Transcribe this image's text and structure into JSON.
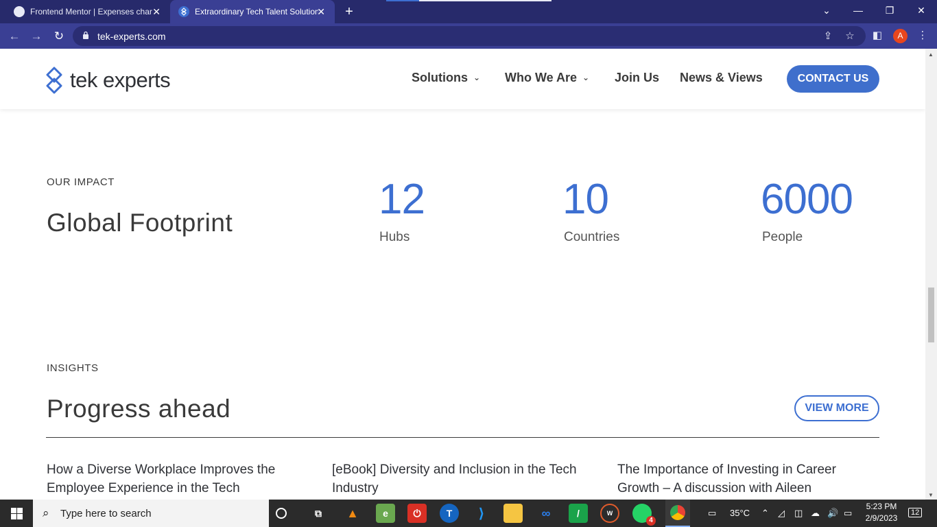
{
  "browser": {
    "tabs": [
      {
        "title": "Frontend Mentor | Expenses char",
        "active": false
      },
      {
        "title": "Extraordinary Tech Talent Solution",
        "active": true
      }
    ],
    "url": "tek-experts.com",
    "profile_initial": "A"
  },
  "site": {
    "logo_text": "tek experts",
    "nav": {
      "solutions": "Solutions",
      "who_we_are": "Who We Are",
      "join_us": "Join Us",
      "news_views": "News & Views",
      "contact": "CONTACT US"
    },
    "impact": {
      "eyebrow": "OUR IMPACT",
      "heading": "Global Footprint",
      "stats": [
        {
          "value": "12",
          "label": "Hubs"
        },
        {
          "value": "10",
          "label": "Countries"
        },
        {
          "value": "6000",
          "label": "People"
        }
      ]
    },
    "insights": {
      "eyebrow": "INSIGHTS",
      "heading": "Progress ahead",
      "view_more": "VIEW MORE",
      "articles": [
        {
          "title": "How a Diverse Workplace Improves the Employee Experience in the Tech"
        },
        {
          "title": "[eBook] Diversity and Inclusion in the Tech Industry"
        },
        {
          "title": "The Importance of Investing in Career Growth – A discussion with Aileen"
        }
      ]
    }
  },
  "taskbar": {
    "search_placeholder": "Type here to search",
    "weather": "35°C",
    "time": "5:23 PM",
    "date": "2/9/2023",
    "notifications": "12",
    "whatsapp_badge": "4"
  },
  "colors": {
    "brand_blue": "#3d6fd1",
    "tab_bar": "#272a6b",
    "toolbar": "#3a3f94"
  }
}
